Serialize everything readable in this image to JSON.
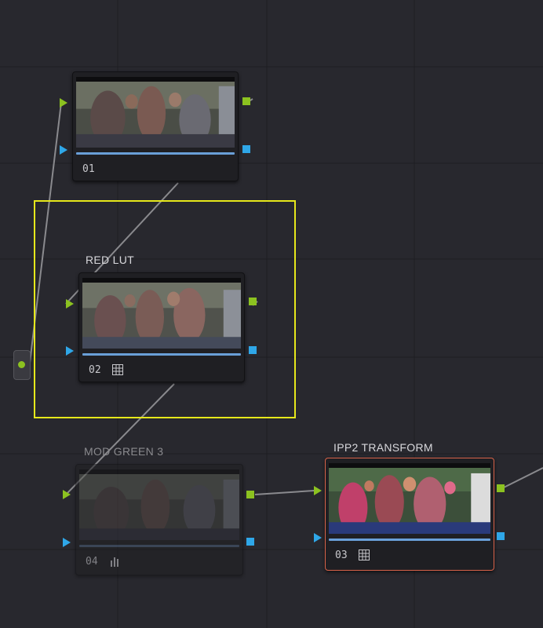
{
  "node_editor": {
    "nodes": [
      {
        "number": "01",
        "label": "",
        "icon": ""
      },
      {
        "number": "02",
        "label": "RED LUT",
        "icon": "lut-grid-icon"
      },
      {
        "number": "04",
        "label": "MOD GREEN 3",
        "icon": "bars-icon",
        "state": "disabled"
      },
      {
        "number": "03",
        "label": "IPP2 TRANSFORM",
        "icon": "lut-grid-icon",
        "state": "selected"
      }
    ],
    "colors": {
      "rgb_input": "#8cc220",
      "alpha_input": "#2fa7e8",
      "selection_box": "#e6e81b",
      "selected_node_border": "#d9634a",
      "background": "#28282e"
    }
  }
}
